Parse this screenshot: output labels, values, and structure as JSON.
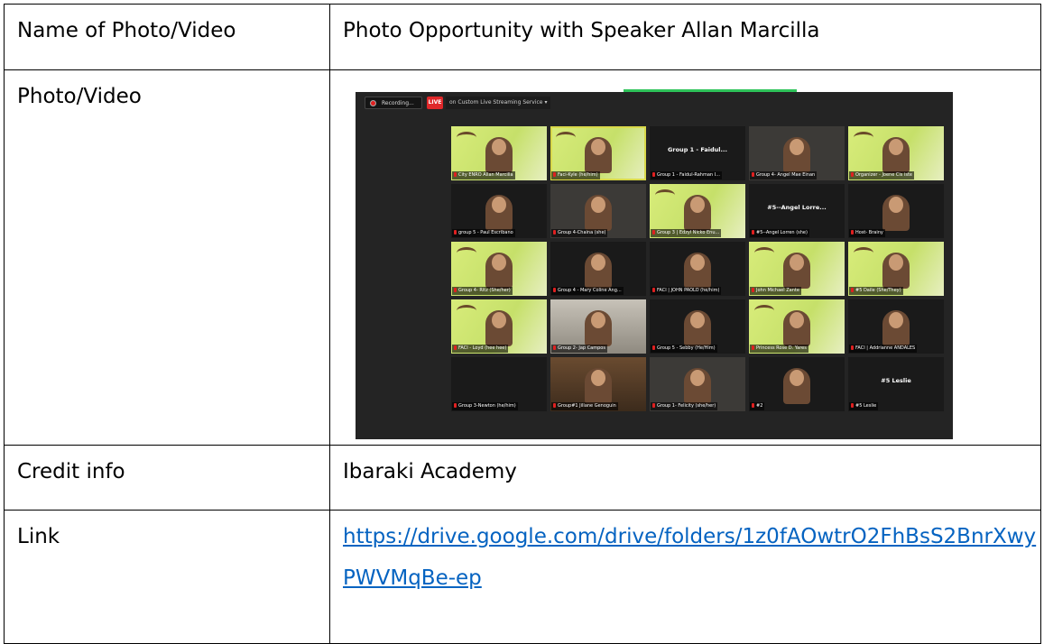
{
  "rows": [
    {
      "label": "Name of Photo/Video",
      "value": "Photo Opportunity with Speaker Allan Marcilla"
    },
    {
      "label": "Photo/Video",
      "value": ""
    },
    {
      "label": "Credit info",
      "value": "Ibaraki Academy"
    },
    {
      "label": "Link",
      "value": "https://drive.google.com/drive/folders/1z0fAOwtrO2FhBsS2BnrXwyPWVMqBe-ep"
    }
  ],
  "colors": {
    "link": "#0563c1",
    "live": "#e0282a",
    "speaking_outline": "#d9d94a",
    "banner_green": "#d8ec7a"
  },
  "zoom": {
    "recording_label": "Recording...",
    "live_label": "LIVE",
    "stream_label": "on Custom Live Streaming Service",
    "tiles": [
      {
        "name": "City ENRO Allan Marcilla",
        "style": "banner"
      },
      {
        "name": "Faci-Kyle (he/him)",
        "style": "banner",
        "speaking": true
      },
      {
        "name": "Group 1 - Faidul-Rahman I...",
        "style": "text",
        "display": "Group 1 - Faidul..."
      },
      {
        "name": "Group 4- Angel Mae Einan",
        "style": "room"
      },
      {
        "name": "Organizer - Joene Cis iste",
        "style": "banner"
      },
      {
        "name": "group 5 - Paul Escribano",
        "style": "plain"
      },
      {
        "name": "Group 4-Chaina (she)",
        "style": "room"
      },
      {
        "name": "Group 3 | Edzyl Nicko Enu...",
        "style": "banner"
      },
      {
        "name": "#5--Angel Lorren (she)",
        "style": "text",
        "display": "#5--Angel Lorre..."
      },
      {
        "name": "Host- Brainy",
        "style": "plain"
      },
      {
        "name": "Group 4- Ritz (She/her)",
        "style": "banner"
      },
      {
        "name": "Group 4 - Mary Coline Ang...",
        "style": "plain"
      },
      {
        "name": "FACI | JOHN PAOLO (he/him)",
        "style": "plain"
      },
      {
        "name": "John Michael Zante",
        "style": "banner"
      },
      {
        "name": "#5 Daile (She/They)",
        "style": "banner"
      },
      {
        "name": "FACI - Loyd (hee hee)",
        "style": "banner"
      },
      {
        "name": "Group 2- Jap Campos",
        "style": "wall"
      },
      {
        "name": "Group 5 - Sebby (He/Him)",
        "style": "plain"
      },
      {
        "name": "Princess Rose D. Yares",
        "style": "banner"
      },
      {
        "name": "FACI | Addrianne ANDALES",
        "style": "plain"
      },
      {
        "name": "Group 3-Newton (he/him)",
        "style": "empty"
      },
      {
        "name": "Group#1 Jillane Genoguin",
        "style": "wood"
      },
      {
        "name": "Group 1- Felicity (she/her)",
        "style": "room"
      },
      {
        "name": "#2",
        "style": "plain"
      },
      {
        "name": "#5 Leslie",
        "style": "text",
        "display": "#5 Leslie"
      }
    ]
  }
}
